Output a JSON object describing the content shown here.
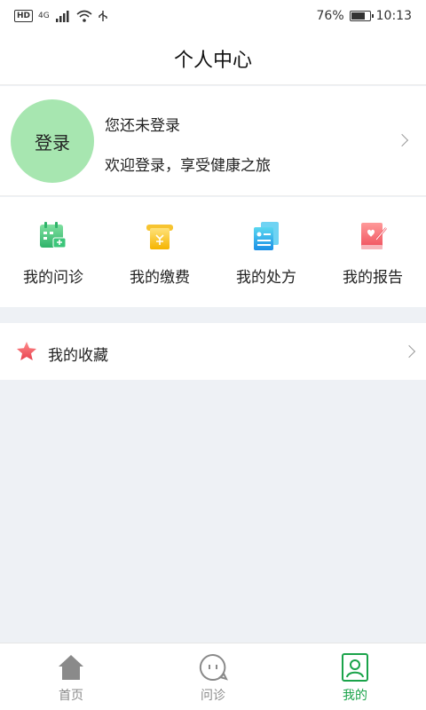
{
  "status_bar": {
    "hd": "HD",
    "signal_tag": "4G",
    "battery": "76%",
    "battery_level": 0.76,
    "time": "10:13"
  },
  "header": {
    "title": "个人中心"
  },
  "profile": {
    "login_label": "登录",
    "status_text": "您还未登录",
    "welcome_text": "欢迎登录，享受健康之旅"
  },
  "quick_actions": [
    {
      "label": "我的问诊",
      "icon": "calendar-clinic-icon"
    },
    {
      "label": "我的缴费",
      "icon": "payment-receipt-icon"
    },
    {
      "label": "我的处方",
      "icon": "prescription-document-icon"
    },
    {
      "label": "我的报告",
      "icon": "report-heart-icon"
    }
  ],
  "favorites": {
    "label": "我的收藏",
    "icon": "star-icon"
  },
  "tab_bar": {
    "tabs": [
      {
        "label": "首页",
        "icon": "home-icon"
      },
      {
        "label": "问诊",
        "icon": "chat-bubble-icon"
      },
      {
        "label": "我的",
        "icon": "profile-icon",
        "active": true
      }
    ]
  },
  "colors": {
    "accent": "#1aa34a",
    "login_circle": "#a7e6b0",
    "background": "#eef1f5"
  }
}
